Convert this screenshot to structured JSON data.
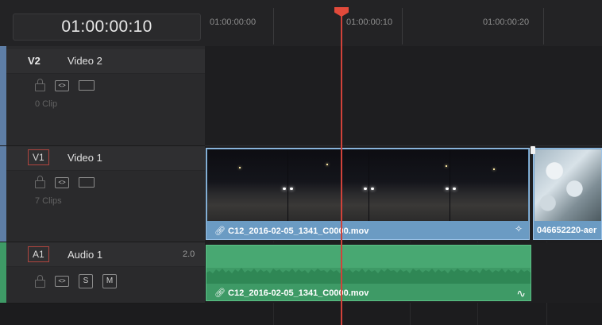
{
  "header": {
    "timecode": "01:00:00:10"
  },
  "ruler": {
    "ticks": [
      "01:00:00:00",
      "01:00:00:10",
      "01:00:00:20"
    ]
  },
  "tracks": {
    "v2": {
      "badge": "V2",
      "name": "Video 2",
      "clips": "0 Clip"
    },
    "v1": {
      "badge": "V1",
      "name": "Video 1",
      "clips": "7 Clips"
    },
    "a1": {
      "badge": "A1",
      "name": "Audio 1",
      "channels": "2.0",
      "solo": "S",
      "mute": "M"
    }
  },
  "clips": {
    "video_main": "C12_2016-02-05_1341_C0000.mov",
    "video_next": "046652220-aer",
    "audio_main": "C12_2016-02-05_1341_C0000.mov"
  },
  "colors": {
    "playhead": "#e24a3b",
    "video_clip": "#6b9bc3",
    "audio_clip": "#3e9a66",
    "video_track_accent": "#5e7ea6",
    "audio_track_accent": "#3e9a66"
  },
  "icons": [
    "lock-icon",
    "auto-select-icon",
    "film-strip-icon",
    "link-icon",
    "sparkle-fx-icon",
    "curve-icon"
  ]
}
